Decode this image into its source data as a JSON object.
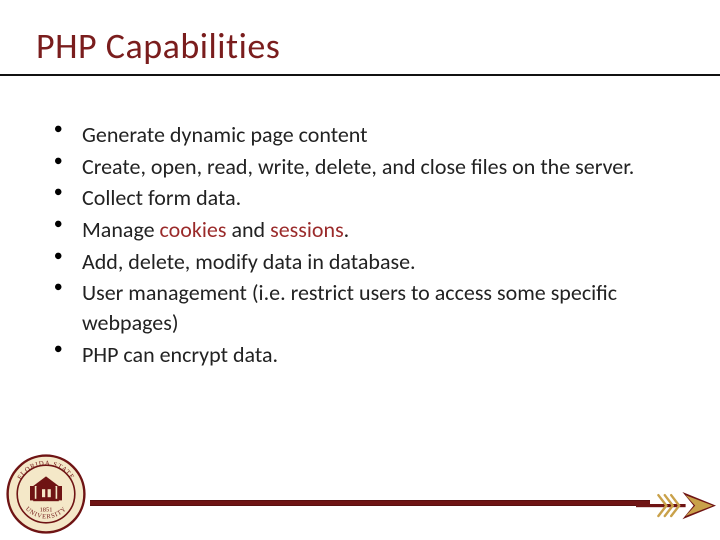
{
  "title": "PHP Capabilities",
  "bullets": [
    {
      "segments": [
        {
          "t": "Generate dynamic page content"
        }
      ]
    },
    {
      "segments": [
        {
          "t": "Create, open, read, write, delete, and close files on the server."
        }
      ]
    },
    {
      "segments": [
        {
          "t": "Collect form data."
        }
      ]
    },
    {
      "segments": [
        {
          "t": "Manage "
        },
        {
          "t": "cookies",
          "hl": true
        },
        {
          "t": " and "
        },
        {
          "t": "sessions",
          "hl": true
        },
        {
          "t": "."
        }
      ]
    },
    {
      "segments": [
        {
          "t": "Add, delete, modify data in database."
        }
      ]
    },
    {
      "segments": [
        {
          "t": "User management (i.e. restrict users to access some specific webpages)"
        }
      ]
    },
    {
      "segments": [
        {
          "t": "PHP can encrypt data."
        }
      ]
    }
  ],
  "seal": {
    "top_text": "FLORIDA STATE",
    "bottom_text": "UNIVERSITY",
    "year": "1851"
  },
  "colors": {
    "garnet": "#6f1414",
    "title": "#7a1d1d",
    "gold": "#c9a14a"
  }
}
